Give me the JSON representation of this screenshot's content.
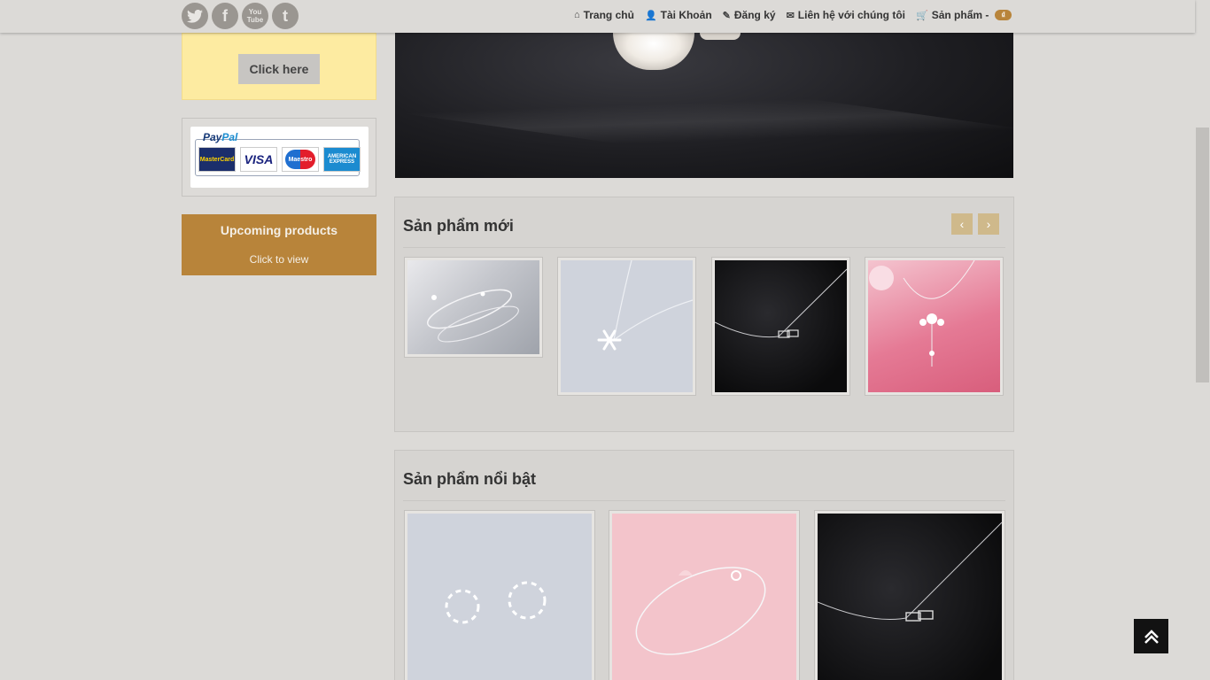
{
  "nav": {
    "items": [
      {
        "icon": "home-icon",
        "label": "Trang chủ"
      },
      {
        "icon": "user-icon",
        "label": "Tài Khoản"
      },
      {
        "icon": "edit-icon",
        "label": "Đăng ký"
      },
      {
        "icon": "envelope-icon",
        "label": "Liên hệ với chúng tôi"
      },
      {
        "icon": "cart-icon",
        "label": "Sản phẩm -"
      }
    ],
    "cart_badge": "₫"
  },
  "social": [
    {
      "icon": "twitter-icon",
      "glyph": "🐦"
    },
    {
      "icon": "facebook-icon",
      "glyph": "f"
    },
    {
      "icon": "youtube-icon",
      "glyph": "You Tube"
    },
    {
      "icon": "tumblr-icon",
      "glyph": "t"
    }
  ],
  "sidebar": {
    "promo_button": "Click here",
    "payment": {
      "paypal_a": "Pay",
      "paypal_b": "Pal",
      "mastercard": "MasterCard",
      "visa": "VISA",
      "maestro": "Maestro",
      "amex": "AMERICAN EXPRESS"
    },
    "upcoming_title": "Upcoming products",
    "upcoming_link": "Click to view"
  },
  "sections": {
    "new_products_title": "Sản phẩm mới",
    "featured_title": "Sản phẩm nổi bật"
  },
  "colors": {
    "accent": "#b8843a",
    "background": "#dcdad7",
    "promo_bg": "#fdeba1"
  }
}
